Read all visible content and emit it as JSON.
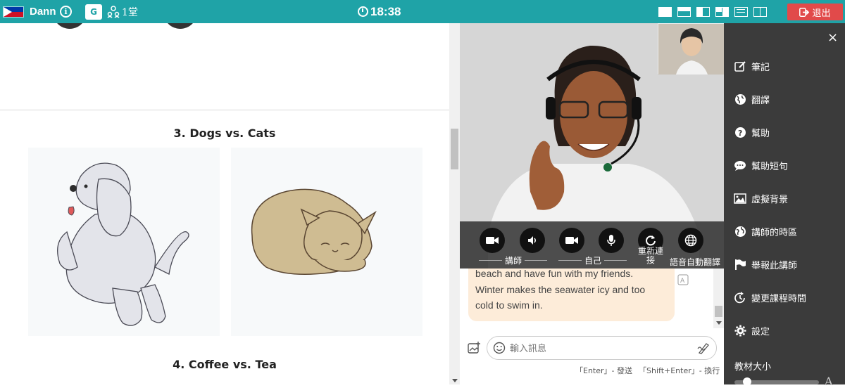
{
  "topbar": {
    "username": "Dann",
    "translate_badge": "G",
    "people_count": "1堂",
    "time": "18:38",
    "exit_label": "退出"
  },
  "material": {
    "heading3": "3. Dogs vs. Cats",
    "heading4": "4. Coffee vs. Tea"
  },
  "video": {
    "controls": [
      {
        "icon": "video-camera-icon"
      },
      {
        "icon": "speaker-icon"
      },
      {
        "icon": "video-camera-icon"
      },
      {
        "icon": "microphone-icon"
      },
      {
        "icon": "refresh-icon"
      },
      {
        "icon": "globe-icon"
      }
    ],
    "teacher_label": "講師",
    "self_label": "自己",
    "reconnect_label": "重新連\n接",
    "auto_translate_label": "語音自動翻譯"
  },
  "chat": {
    "message_lines": [
      "beach and have fun with my friends.",
      "Winter makes the seawater icy and too",
      "cold to swim in."
    ],
    "input_placeholder": "輸入訊息",
    "hint_enter": "「Enter」- 發送",
    "hint_shift": "「Shift+Enter」- 換行"
  },
  "sidebar": {
    "items": [
      {
        "label": "筆記",
        "icon": "edit-icon"
      },
      {
        "label": "翻譯",
        "icon": "globe-icon"
      },
      {
        "label": "幫助",
        "icon": "question-icon"
      },
      {
        "label": "幫助短句",
        "icon": "chat-bubble-icon"
      },
      {
        "label": "虛擬背景",
        "icon": "image-icon"
      },
      {
        "label": "講師的時區",
        "icon": "world-icon"
      },
      {
        "label": "舉報此講師",
        "icon": "flag-icon"
      },
      {
        "label": "變更課程時間",
        "icon": "clock-rotate-icon"
      },
      {
        "label": "設定",
        "icon": "gear-icon"
      }
    ],
    "font_size_label": "教材大小",
    "close_glyph": "×"
  }
}
